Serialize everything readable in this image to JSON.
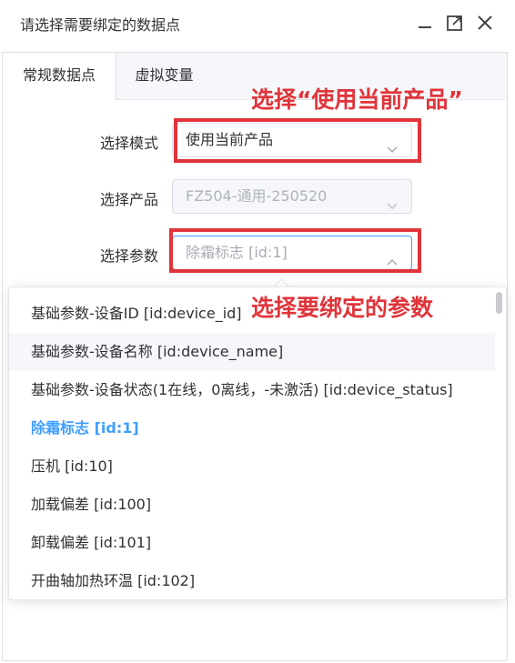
{
  "dialog": {
    "title": "请选择需要绑定的数据点",
    "icons": [
      "minimize-icon",
      "maximize-icon",
      "close-icon"
    ]
  },
  "tabs": [
    {
      "label": "常规数据点",
      "active": true
    },
    {
      "label": "虚拟变量",
      "active": false
    }
  ],
  "form": {
    "mode_label": "选择模式",
    "mode_value": "使用当前产品",
    "product_label": "选择产品",
    "product_value": "FZ504-通用-250520",
    "param_label": "选择参数",
    "param_placeholder": "除霜标志 [id:1]"
  },
  "annotations": {
    "mode_note": "选择“使用当前产品”",
    "param_note": "选择要绑定的参数"
  },
  "dropdown": {
    "options": [
      "基础参数-设备ID [id:device_id]",
      "基础参数-设备名称 [id:device_name]",
      "基础参数-设备状态(1在线，0离线，-未激活) [id:device_status]",
      "除霜标志 [id:1]",
      "压机 [id:10]",
      "加载偏差 [id:100]",
      "卸载偏差 [id:101]",
      "开曲轴加热环温 [id:102]"
    ],
    "selected_index": 3,
    "hover_index": 1
  },
  "colors": {
    "accent": "#409eff",
    "annotation_red": "#e0343a",
    "border": "#dcdfe6"
  }
}
